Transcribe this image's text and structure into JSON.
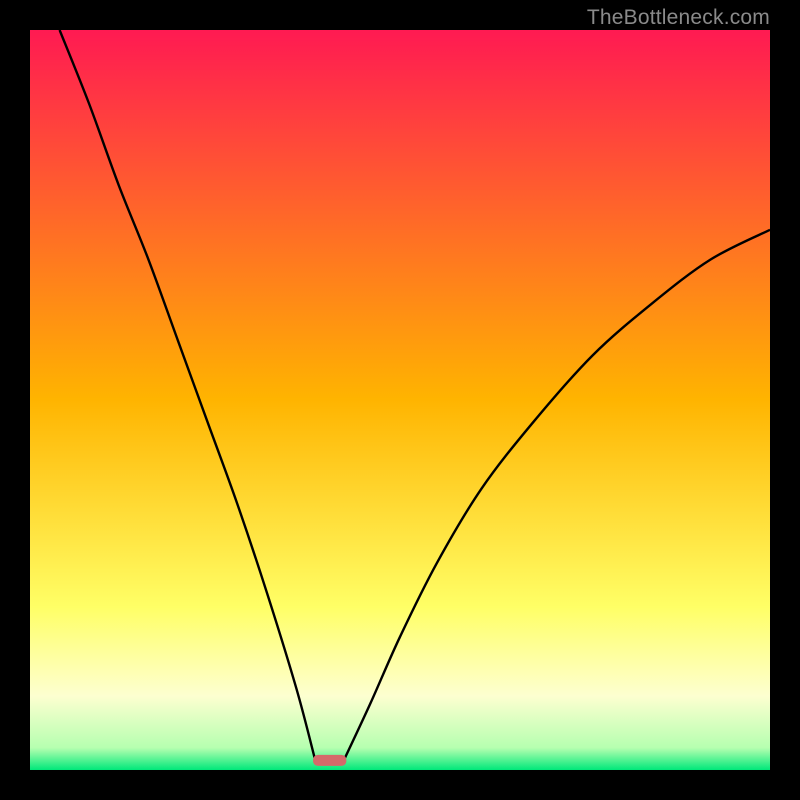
{
  "watermark": "TheBottleneck.com",
  "chart_data": {
    "type": "line",
    "title": "",
    "xlabel": "",
    "ylabel": "",
    "xlim": [
      0,
      1
    ],
    "ylim": [
      0,
      1
    ],
    "grid": false,
    "legend": false,
    "background_gradient_stops": [
      {
        "offset": 0.0,
        "color": "#ff1a52"
      },
      {
        "offset": 0.5,
        "color": "#ffb400"
      },
      {
        "offset": 0.78,
        "color": "#ffff66"
      },
      {
        "offset": 0.9,
        "color": "#fdffd0"
      },
      {
        "offset": 0.97,
        "color": "#b6ffb0"
      },
      {
        "offset": 1.0,
        "color": "#00e87a"
      }
    ],
    "curve_left": {
      "name": "left-branch",
      "comment": "Approximate: starts near top-left, descends to minimum ~x=0.39",
      "x": [
        0.04,
        0.08,
        0.12,
        0.16,
        0.2,
        0.24,
        0.28,
        0.32,
        0.36,
        0.385
      ],
      "y": [
        1.0,
        0.9,
        0.79,
        0.69,
        0.58,
        0.47,
        0.36,
        0.24,
        0.11,
        0.015
      ]
    },
    "curve_right": {
      "name": "right-branch",
      "comment": "Approximate: rises from minimum ~x=0.42 to ~0.73 at right edge",
      "x": [
        0.425,
        0.46,
        0.5,
        0.55,
        0.61,
        0.68,
        0.76,
        0.84,
        0.92,
        1.0
      ],
      "y": [
        0.015,
        0.09,
        0.18,
        0.28,
        0.38,
        0.47,
        0.56,
        0.63,
        0.69,
        0.73
      ]
    },
    "marker": {
      "comment": "Small rounded red bar at the bottom between the two curves",
      "x_center": 0.405,
      "y_center": 0.013,
      "width": 0.045,
      "height": 0.015,
      "color": "#d46a6a"
    }
  }
}
